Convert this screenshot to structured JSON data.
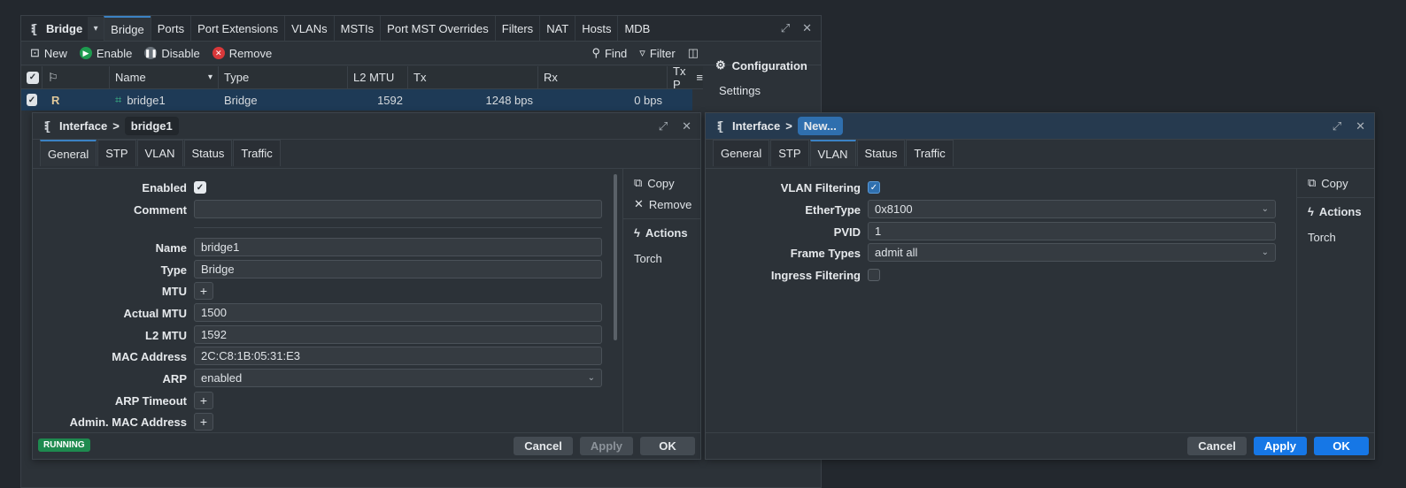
{
  "bridge_window": {
    "title": "Bridge",
    "tabs": [
      "Bridge",
      "Ports",
      "Port Extensions",
      "VLANs",
      "MSTIs",
      "Port MST Overrides",
      "Filters",
      "NAT",
      "Hosts",
      "MDB"
    ],
    "toolbar": {
      "new": "New",
      "enable": "Enable",
      "disable": "Disable",
      "remove": "Remove",
      "find": "Find",
      "filter": "Filter"
    },
    "columns": [
      "Name",
      "Type",
      "L2 MTU",
      "Tx",
      "Rx",
      "Tx P"
    ],
    "row": {
      "flag": "R",
      "name": "bridge1",
      "type": "Bridge",
      "l2mtu": "1592",
      "tx": "1248 bps",
      "rx": "0 bps"
    },
    "config": {
      "heading": "Configuration",
      "settings": "Settings"
    }
  },
  "iface1": {
    "title": "Interface",
    "crumb": "bridge1",
    "tabs": [
      "General",
      "STP",
      "VLAN",
      "Status",
      "Traffic"
    ],
    "active_tab": "General",
    "labels": {
      "enabled": "Enabled",
      "comment": "Comment",
      "name": "Name",
      "type": "Type",
      "mtu": "MTU",
      "actual_mtu": "Actual MTU",
      "l2mtu": "L2 MTU",
      "mac": "MAC Address",
      "arp": "ARP",
      "arp_timeout": "ARP Timeout",
      "admin_mac": "Admin. MAC Address"
    },
    "values": {
      "name": "bridge1",
      "type": "Bridge",
      "actual_mtu": "1500",
      "l2mtu": "1592",
      "mac": "2C:C8:1B:05:31:E3",
      "arp": "enabled"
    },
    "side": {
      "copy": "Copy",
      "remove": "Remove",
      "actions": "Actions",
      "torch": "Torch"
    },
    "status": "RUNNING",
    "buttons": {
      "cancel": "Cancel",
      "apply": "Apply",
      "ok": "OK"
    }
  },
  "iface2": {
    "title": "Interface",
    "crumb": "New...",
    "tabs": [
      "General",
      "STP",
      "VLAN",
      "Status",
      "Traffic"
    ],
    "active_tab": "VLAN",
    "labels": {
      "vlan_filtering": "VLAN Filtering",
      "ethertype": "EtherType",
      "pvid": "PVID",
      "frame_types": "Frame Types",
      "ingress_filtering": "Ingress Filtering"
    },
    "values": {
      "ethertype": "0x8100",
      "pvid": "1",
      "frame_types": "admit all"
    },
    "side": {
      "copy": "Copy",
      "actions": "Actions",
      "torch": "Torch"
    },
    "buttons": {
      "cancel": "Cancel",
      "apply": "Apply",
      "ok": "OK"
    }
  }
}
